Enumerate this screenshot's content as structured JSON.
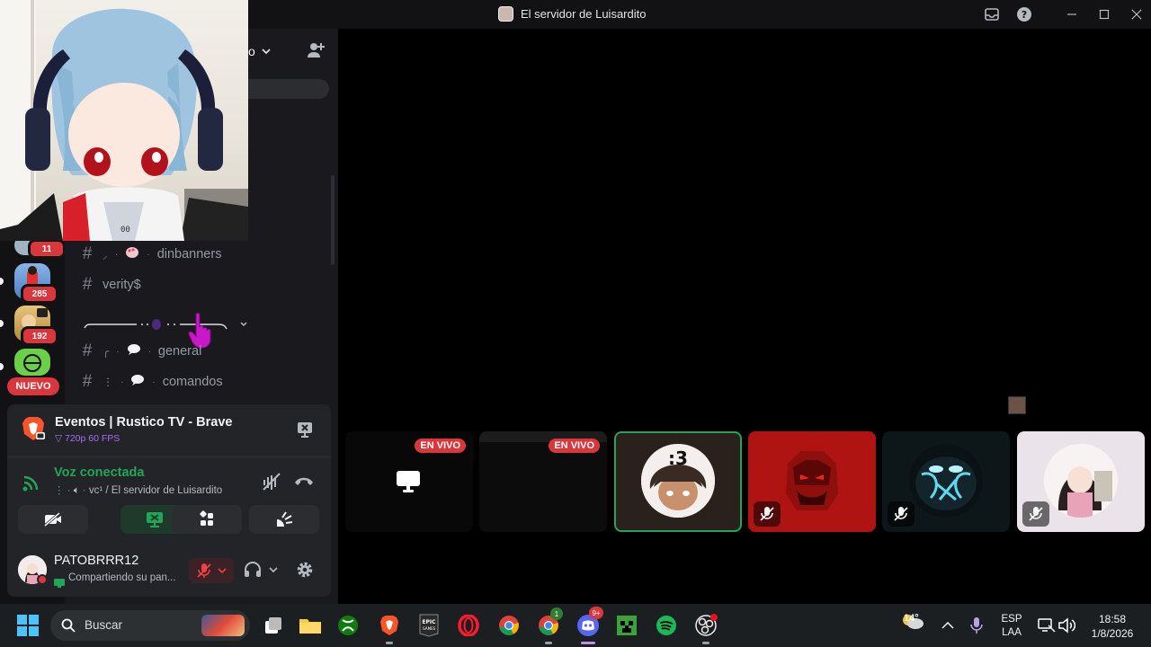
{
  "window": {
    "title": "El servidor de Luisardito"
  },
  "guilds": [
    {
      "name": "guild-1",
      "badge": "11"
    },
    {
      "name": "guild-2",
      "badge": "285"
    },
    {
      "name": "guild-3",
      "badge": "192"
    },
    {
      "name": "guild-4",
      "badge": ""
    }
  ],
  "guild_new_badge": "NUEVO",
  "channels": [
    {
      "name": "dinbanners"
    },
    {
      "name": "verity$"
    },
    {
      "name": "general"
    },
    {
      "name": "comandos"
    }
  ],
  "stream": {
    "title": "Eventos | Rustico TV - Brave",
    "quality": "720p 60 FPS"
  },
  "voice": {
    "status": "Voz conectada",
    "channel": "vc¹ / El servidor de Luisardito"
  },
  "user": {
    "name": "PATOBRRR12",
    "status": "Compartiendo su pan..."
  },
  "tiles": [
    {
      "kind": "stream",
      "badge": "EN VIVO"
    },
    {
      "kind": "stream",
      "badge": "EN VIVO"
    },
    {
      "kind": "user",
      "label": ":3",
      "speaking": true
    },
    {
      "kind": "user",
      "muted": true
    },
    {
      "kind": "user",
      "muted": true
    },
    {
      "kind": "user",
      "muted": true
    }
  ],
  "taskbar": {
    "search_placeholder": "Buscar",
    "weather": "14°",
    "lang_line1": "ESP",
    "lang_line2": "LAA",
    "time": "18:58",
    "date": "1/8/2026",
    "discord_badge": "9+",
    "chrome_badge": "1"
  },
  "colors": {
    "accent_green": "#23a559",
    "live_red": "#da373c",
    "stream_purple": "#a56cf7"
  }
}
